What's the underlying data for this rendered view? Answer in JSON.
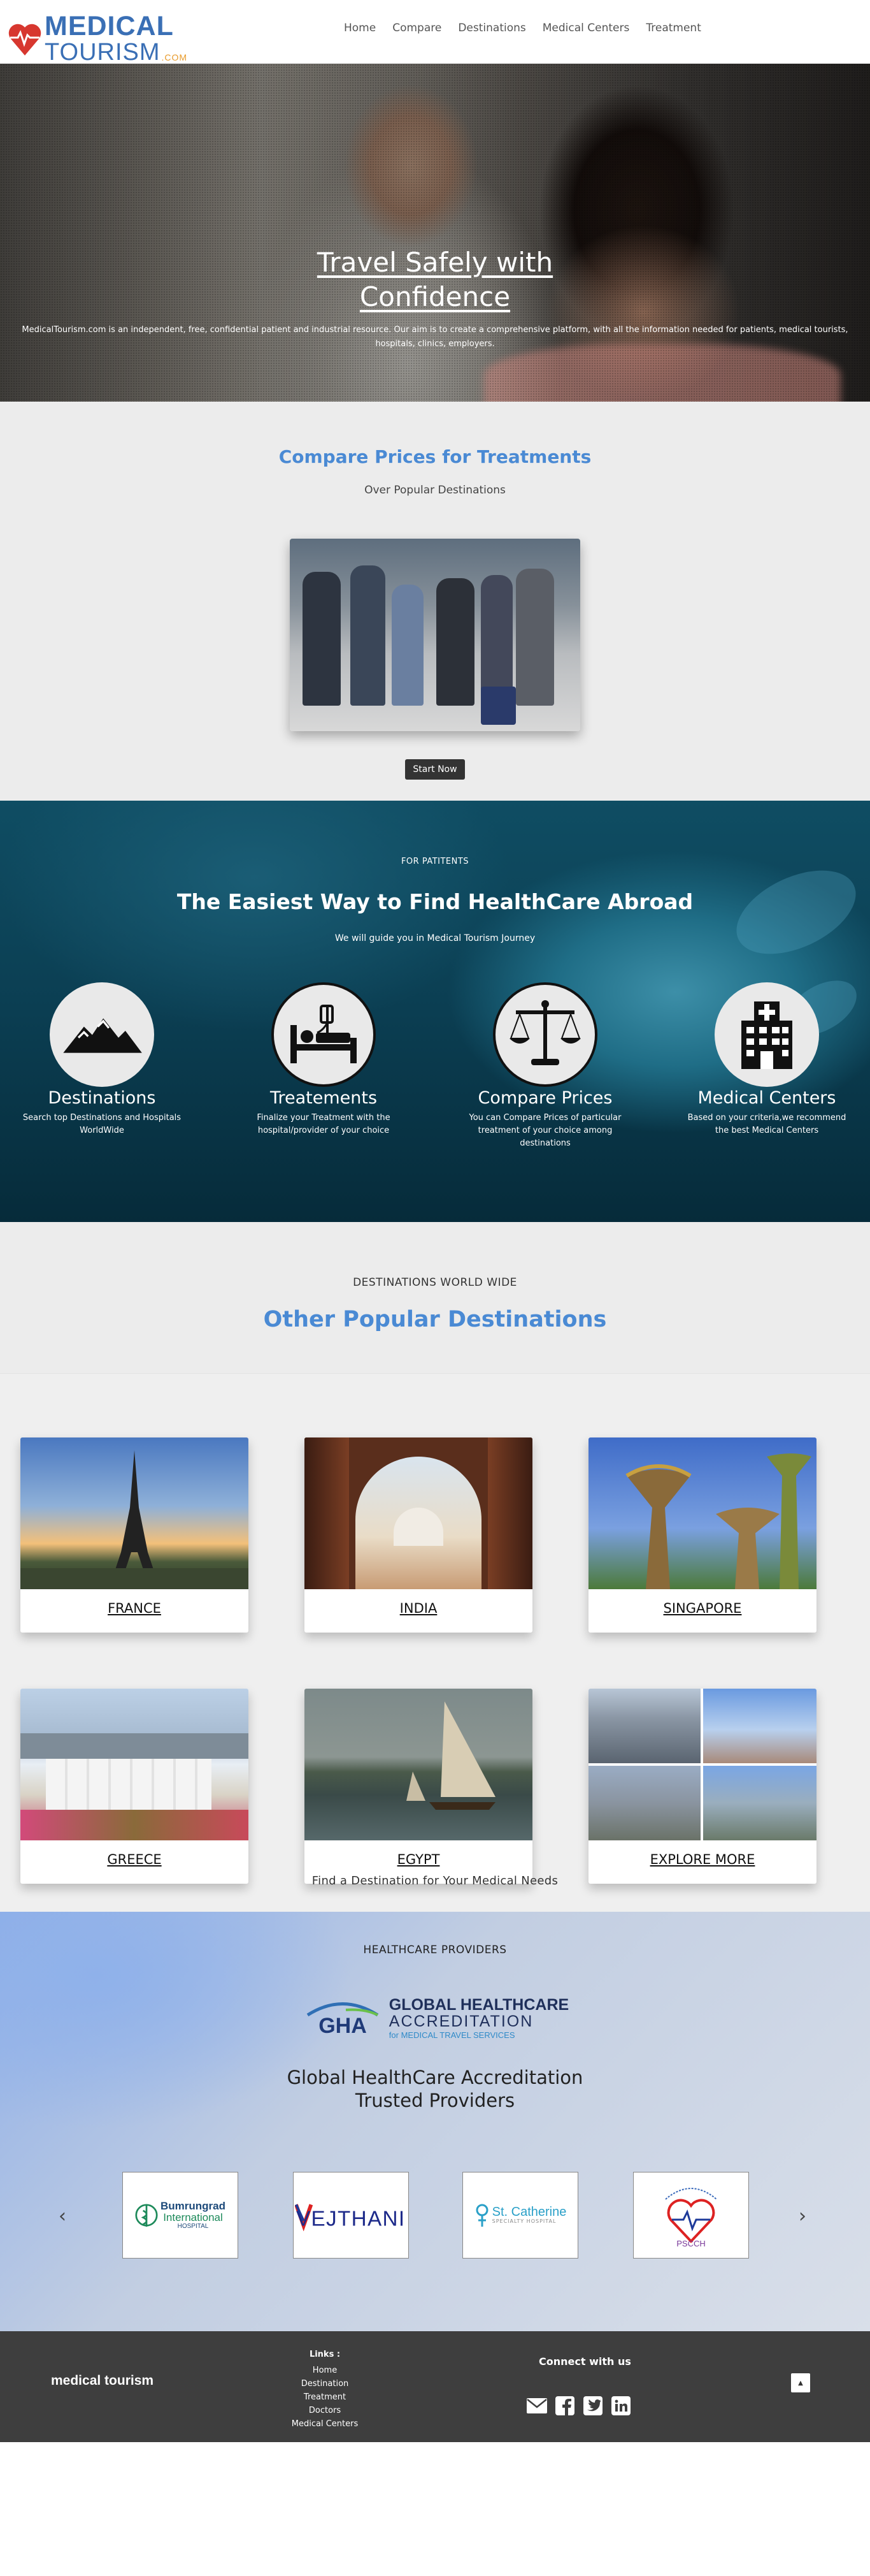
{
  "brand": {
    "line1": "MEDICAL",
    "line2": "TOURISM",
    "suffix": ".COM",
    "accent": "#3a6fb5",
    "orange": "#e89a2a"
  },
  "nav": {
    "items": [
      "Home",
      "Compare",
      "Destinations",
      "Medical Centers",
      "Treatment"
    ]
  },
  "hero": {
    "title": "Travel Safely with Confidence",
    "description": "MedicalTourism.com is an independent, free, confidential patient and industrial resource. Our aim is to create a comprehensive platform, with all the information needed for patients, medical tourists, hospitals, clinics, employers."
  },
  "compare": {
    "title": "Compare Prices for Treatments",
    "subtitle": "Over Popular Destinations",
    "button": "Start Now",
    "title_color": "#4a8ad4"
  },
  "patients": {
    "kicker": "FOR PATITENTS",
    "title": "The Easiest Way to Find HealthCare Abroad",
    "tagline": "We will guide you in Medical Tourism Journey",
    "features": [
      {
        "icon": "mountains-icon",
        "title": "Destinations",
        "text": "Search top Destinations and Hospitals WorldWide"
      },
      {
        "icon": "hospital-bed-icon",
        "title": "Treatements",
        "text": "Finalize your Treatment with the hospital/provider of your choice"
      },
      {
        "icon": "scales-icon",
        "title": "Compare Prices",
        "text": "You can Compare Prices of particular treatment of your choice among destinations"
      },
      {
        "icon": "hospital-building-icon",
        "title": "Medical Centers",
        "text": "Based on your criteria,we recommend the best Medical Centers"
      }
    ]
  },
  "destinations": {
    "kicker": "DESTINATIONS WORLD WIDE",
    "title": "Other Popular Destinations",
    "cards": [
      "FRANCE",
      "INDIA",
      "SINGAPORE",
      "GREECE",
      "EGYPT",
      "EXPLORE MORE"
    ],
    "find": "Find a Destination for Your Medical Needs"
  },
  "providers": {
    "kicker": "HEALTHCARE PROVIDERS",
    "gha": {
      "abbr": "GHA",
      "line1": "GLOBAL HEALTHCARE",
      "line2": "ACCREDITATION",
      "line3": "for MEDICAL TRAVEL SERVICES"
    },
    "title_line1": "Global HealthCare Accreditation",
    "title_line2": "Trusted Providers",
    "logos": [
      {
        "name": "Bumrungrad",
        "sub1": "International",
        "sub2": "HOSPITAL"
      },
      {
        "name": "VEJTHANI"
      },
      {
        "name": "St. Catherine",
        "sub1": "SPECIALTY HOSPITAL"
      },
      {
        "name": "PSCCH"
      }
    ]
  },
  "footer": {
    "brand": "medical tourism",
    "links_title": "Links :",
    "links": [
      "Home",
      "Destination",
      "Treatment",
      "Doctors",
      "Medical Centers"
    ],
    "connect": "Connect with us",
    "social": [
      "envelope-icon",
      "facebook-icon",
      "twitter-icon",
      "linkedin-icon"
    ]
  }
}
